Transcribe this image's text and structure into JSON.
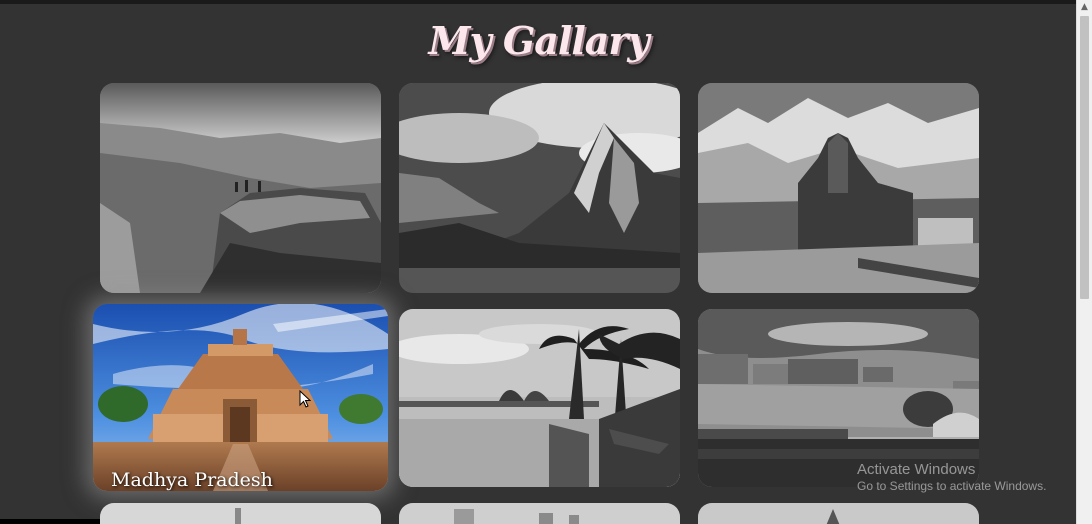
{
  "page": {
    "title": "My Gallary"
  },
  "gallery": {
    "cards": [
      {
        "name": "cliff-fort-photo",
        "caption": ""
      },
      {
        "name": "mountain-peak-photo",
        "caption": ""
      },
      {
        "name": "himalayan-temple-photo",
        "caption": ""
      },
      {
        "name": "stupa-photo",
        "caption": "Madhya Pradesh"
      },
      {
        "name": "backwater-palms-photo",
        "caption": ""
      },
      {
        "name": "lakeside-fort-photo",
        "caption": ""
      }
    ]
  },
  "watermark": {
    "title": "Activate Windows",
    "subtitle": "Go to Settings to activate Windows."
  },
  "colors": {
    "background": "#333333",
    "title": "#fbe7ec"
  },
  "icons": {
    "cursor": "mouse-pointer-icon",
    "scroll_up": "scroll-up-arrow-icon"
  }
}
